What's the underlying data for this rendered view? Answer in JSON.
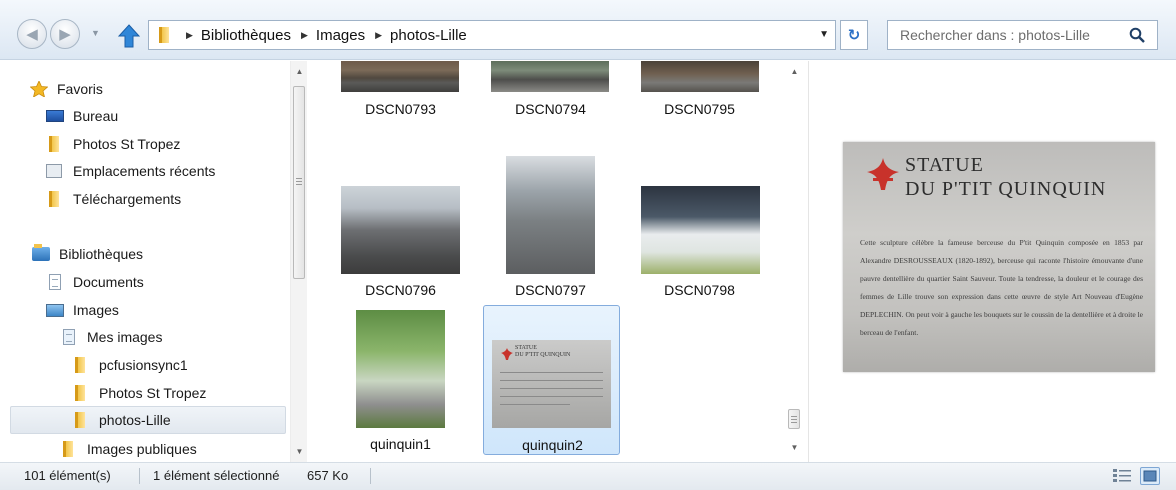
{
  "toolbar": {
    "breadcrumbs": [
      "Bibliothèques",
      "Images",
      "photos-Lille"
    ],
    "search_placeholder": "Rechercher dans : photos-Lille"
  },
  "nav": {
    "favorites_header": "Favoris",
    "favorites": [
      "Bureau",
      "Photos St Tropez",
      "Emplacements récents",
      "Téléchargements"
    ],
    "libraries_header": "Bibliothèques",
    "libraries": [
      "Documents",
      "Images",
      "Mes images",
      "pcfusionsync1",
      "Photos St Tropez",
      "photos-Lille",
      "Images publiques"
    ],
    "selected": "photos-Lille"
  },
  "files": [
    {
      "name": "DSCN0793"
    },
    {
      "name": "DSCN0794"
    },
    {
      "name": "DSCN0795"
    },
    {
      "name": "DSCN0796"
    },
    {
      "name": "DSCN0797"
    },
    {
      "name": "DSCN0798"
    },
    {
      "name": "quinquin1"
    },
    {
      "name": "quinquin2"
    }
  ],
  "selected_file": "quinquin2",
  "preview": {
    "title_line1": "STATUE",
    "title_line2": "DU P'TIT QUINQUIN",
    "body": "Cette sculpture célèbre la fameuse berceuse du P'tit Quinquin composée en 1853 par Alexandre DESROUSSEAUX (1820-1892), berceuse qui raconte l'histoire émouvante d'une pauvre dentellière du quartier Saint Sauveur. Toute la tendresse, la douleur et le courage des femmes de Lille trouve son expression dans cette œuvre de style Art Nouveau d'Eugène DEPLECHIN. On peut voir à gauche les bouquets sur le coussin de la dentellière et à droite le berceau de l'enfant.",
    "small_title_line1": "STATUE",
    "small_title_line2": "DU P'TIT QUINQUIN"
  },
  "status": {
    "count": "101 élément(s)",
    "selection": "1 élément sélectionné",
    "size": "657 Ko"
  },
  "colors": {
    "selection_bg": "#cfe6fb",
    "selection_border": "#84acdd",
    "link_blue": "#2a6fc6",
    "folder_yellow": "#f2c64a",
    "lille_red": "#c8322b"
  }
}
